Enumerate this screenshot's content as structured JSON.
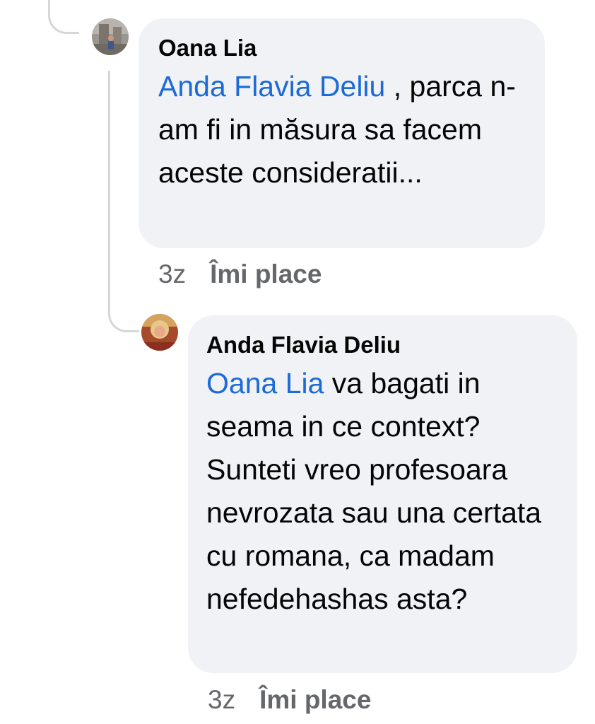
{
  "comments": [
    {
      "author": "Oana Lia",
      "mention": "Anda Flavia Deliu",
      "text": " , parca n-am fi in măsura sa facem aceste consideratii...",
      "time": "3z",
      "like_label": "Îmi place",
      "avatar_icon": "profile-photo"
    },
    {
      "author": "Anda Flavia Deliu",
      "mention": "Oana Lia",
      "text": " va bagati in seama in ce context? Sunteti vreo profesoara nevrozata sau una certata cu romana, ca madam nefedehashas asta?",
      "time": "3z",
      "like_label": "Îmi place",
      "avatar_icon": "profile-photo"
    }
  ],
  "colors": {
    "bubble": "#f0f2f5",
    "mention": "#1b6ad8",
    "meta": "#65676b",
    "thread_line": "#d4d6da"
  }
}
